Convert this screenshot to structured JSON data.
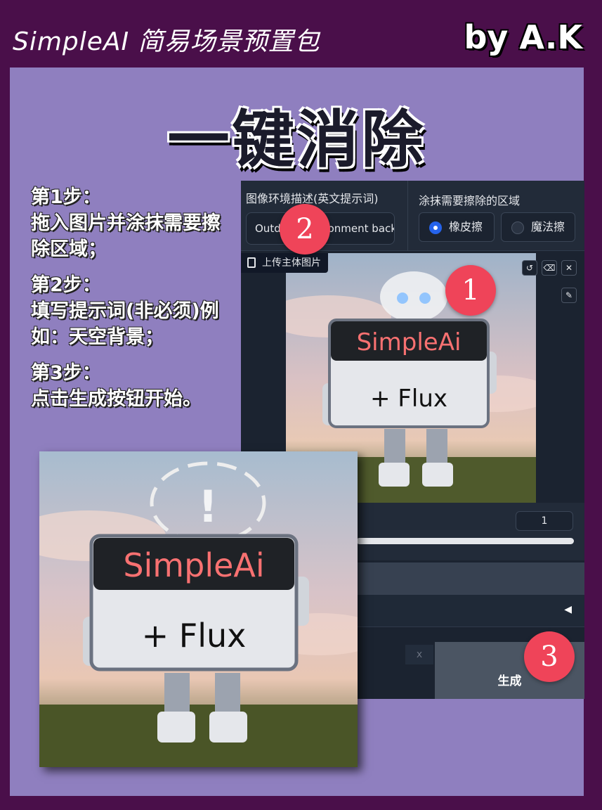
{
  "header": {
    "brand": "SimpleAI 简易场景预置包",
    "author": "by A.K"
  },
  "headline": "一键消除",
  "steps": [
    {
      "title": "第1步：",
      "body": "拖入图片并涂抹需要擦除区域；"
    },
    {
      "title": "第2步：",
      "body": "填写提示词(非必须)例如：天空背景；"
    },
    {
      "title": "第3步：",
      "body": "点击生成按钮开始。"
    }
  ],
  "ui": {
    "prompt_label": "图像环境描述(英文提示词)",
    "prompt_value": "Outdoor environment back",
    "area_label": "涂抹需要擦除的区域",
    "options": [
      {
        "label": "橡皮擦",
        "selected": true
      },
      {
        "label": "魔法擦",
        "selected": false
      }
    ],
    "upload_label": "上传主体图片",
    "number_value": "1",
    "clear_label": "x",
    "generate_label": "生成"
  },
  "sign": {
    "top_text": "SimpleAi",
    "bottom_text": "+ Flux",
    "mark": "!"
  },
  "badges": [
    "1",
    "2",
    "3"
  ]
}
